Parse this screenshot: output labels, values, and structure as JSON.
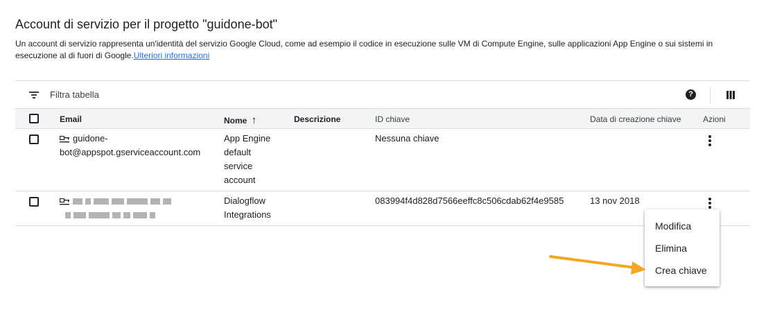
{
  "header": {
    "title": "Account di servizio per il progetto \"guidone-bot\"",
    "description": "Un account di servizio rappresenta un'identità del servizio Google Cloud, come ad esempio il codice in esecuzione sulle VM di Compute Engine, sulle applicazioni App Engine o sui sistemi in esecuzione al di fuori di Google.",
    "learn_more_link": "Ulteriori informazioni"
  },
  "toolbar": {
    "filter_label": "Filtra tabella",
    "help_glyph": "?"
  },
  "table": {
    "columns": {
      "email": "Email",
      "name": "Nome",
      "sort_arrow": "↑",
      "description": "Descrizione",
      "key_id": "ID chiave",
      "key_created": "Data di creazione chiave",
      "actions": "Azioni"
    },
    "rows": [
      {
        "email_line1": "guidone-",
        "email_line2": "bot@appspot.gserviceaccount.com",
        "name_lines": [
          "App Engine",
          "default",
          "service",
          "account"
        ],
        "description": "",
        "key_id": "Nessuna chiave",
        "key_created": ""
      },
      {
        "email_line1": "",
        "email_line2": "",
        "name_lines": [
          "Dialogflow",
          "Integrations"
        ],
        "description": "",
        "key_id": "083994f4d828d7566eeffc8c506cdab62f4e9585",
        "key_created": "13 nov 2018"
      }
    ]
  },
  "actions_menu": {
    "items": [
      "Modifica",
      "Elimina",
      "Crea chiave"
    ]
  },
  "icons": {
    "filter": "filter-list-icon",
    "help": "help-icon",
    "columns": "column-display-icon",
    "service_account": "service-account-key-icon",
    "more": "more-vert-icon",
    "annotation": "annotation-arrow"
  },
  "colors": {
    "link": "#1a73e8",
    "header_bg": "#f1f3f4",
    "border": "#dadce0",
    "annotation_arrow": "#f5a623"
  }
}
